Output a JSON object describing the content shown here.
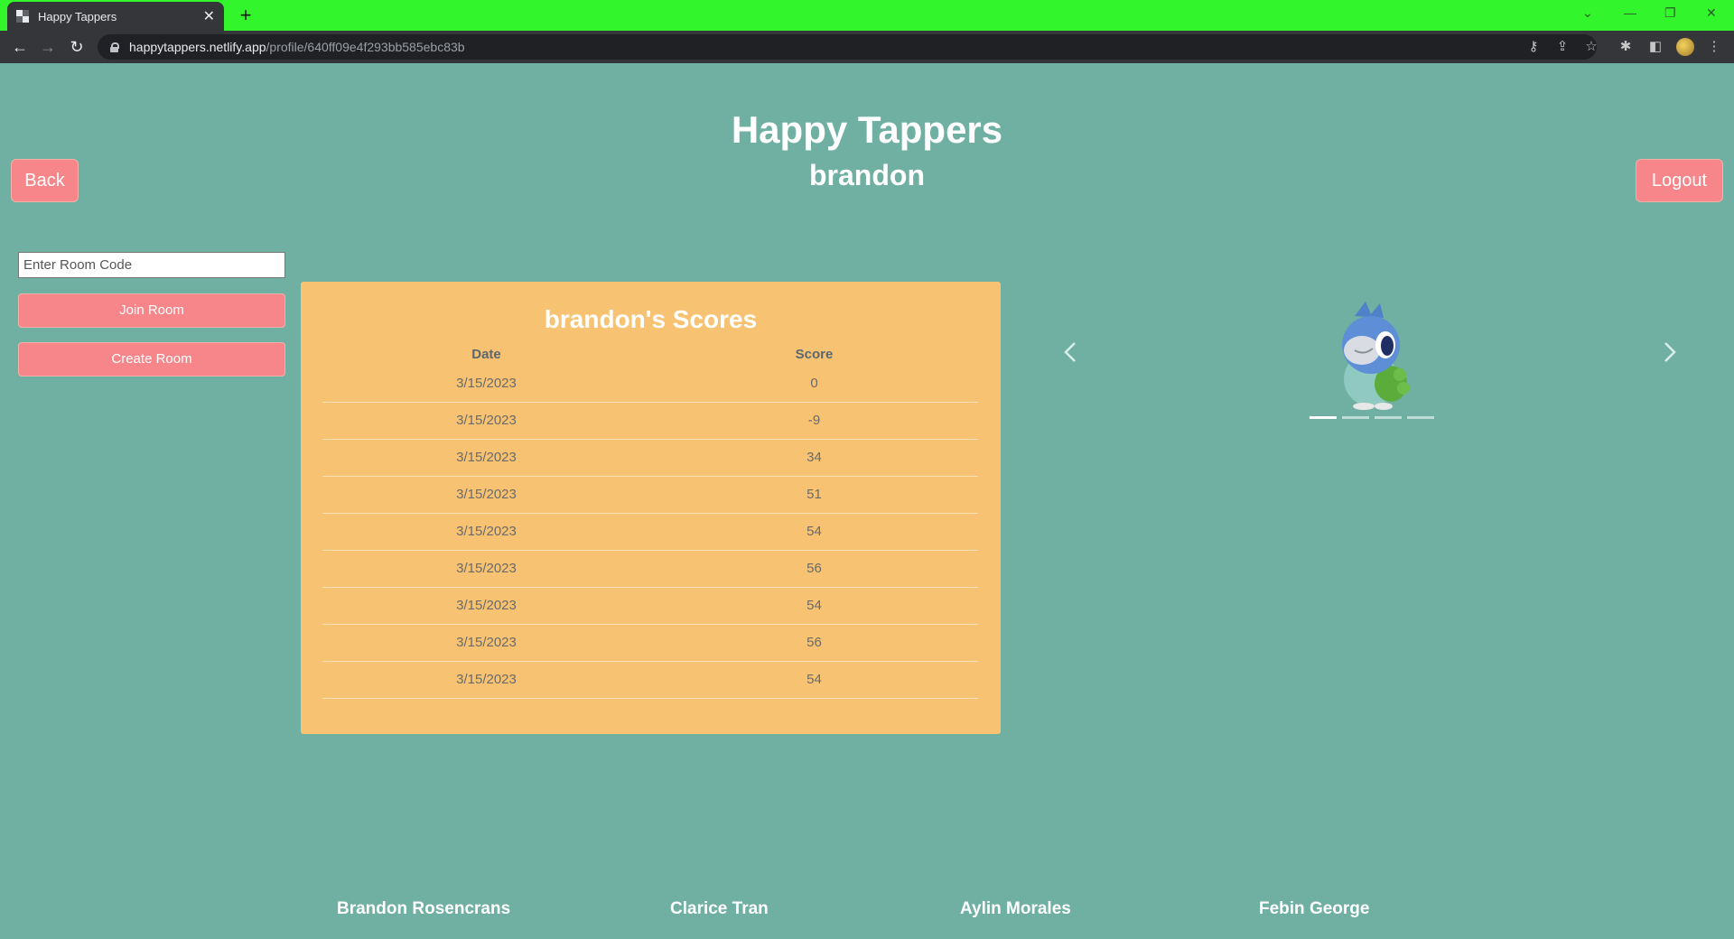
{
  "browser": {
    "tab_title": "Happy Tappers",
    "tab_close": "✕",
    "new_tab": "+",
    "url_host": "happytappers.netlify.app",
    "url_path": "/profile/640ff09e4f293bb585ebc83b"
  },
  "header": {
    "title": "Happy Tappers",
    "username": "brandon",
    "back_label": "Back",
    "logout_label": "Logout"
  },
  "room": {
    "placeholder": "Enter Room Code",
    "join_label": "Join Room",
    "create_label": "Create Room"
  },
  "scores": {
    "title": "brandon's Scores",
    "columns": [
      "Date",
      "Score"
    ],
    "rows": [
      [
        "3/15/2023",
        "0"
      ],
      [
        "3/15/2023",
        "-9"
      ],
      [
        "3/15/2023",
        "34"
      ],
      [
        "3/15/2023",
        "51"
      ],
      [
        "3/15/2023",
        "54"
      ],
      [
        "3/15/2023",
        "56"
      ],
      [
        "3/15/2023",
        "54"
      ],
      [
        "3/15/2023",
        "56"
      ],
      [
        "3/15/2023",
        "54"
      ]
    ]
  },
  "carousel": {
    "slide_count": 4,
    "active_index": 0,
    "image": "bird-character"
  },
  "footer": {
    "credits": [
      "Brandon Rosencrans",
      "Clarice Tran",
      "Aylin Morales",
      "Febin George"
    ]
  },
  "colors": {
    "tabstrip": "#33f52b",
    "background": "#6fb0a3",
    "button": "#f7868a",
    "card": "#f7c373"
  }
}
